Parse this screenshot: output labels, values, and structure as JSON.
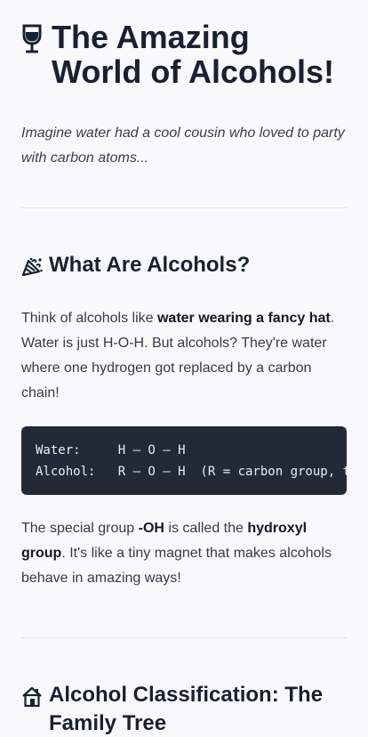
{
  "header": {
    "title": "The Amazing World of Alcohols!",
    "icon": "wine-glass-icon",
    "intro": "Imagine water had a cool cousin who loved to party with carbon atoms..."
  },
  "what_section": {
    "heading": "What Are Alcohols?",
    "icon": "party-popper-icon",
    "p1_before": "Think of alcohols like ",
    "p1_strong": "water wearing a fancy hat",
    "p1_after": ". Water is just H-O-H. But alcohols? They're water where one hydrogen got replaced by a carbon chain!",
    "code_line1": "Water:     H — O — H",
    "code_line2": "Alcohol:   R — O — H  (R = carbon group, t",
    "p2_before": "The special group ",
    "p2_strong1": "-OH",
    "p2_mid": " is called the ",
    "p2_strong2": "hydroxyl group",
    "p2_after": ". It's like a tiny magnet that makes alcohols behave in amazing ways!"
  },
  "classification_section": {
    "heading": "Alcohol Classification: The Family Tree",
    "icon": "house-icon"
  },
  "colors": {
    "background": "#f8f9fa",
    "heading": "#182033",
    "code_background": "#232a37"
  }
}
